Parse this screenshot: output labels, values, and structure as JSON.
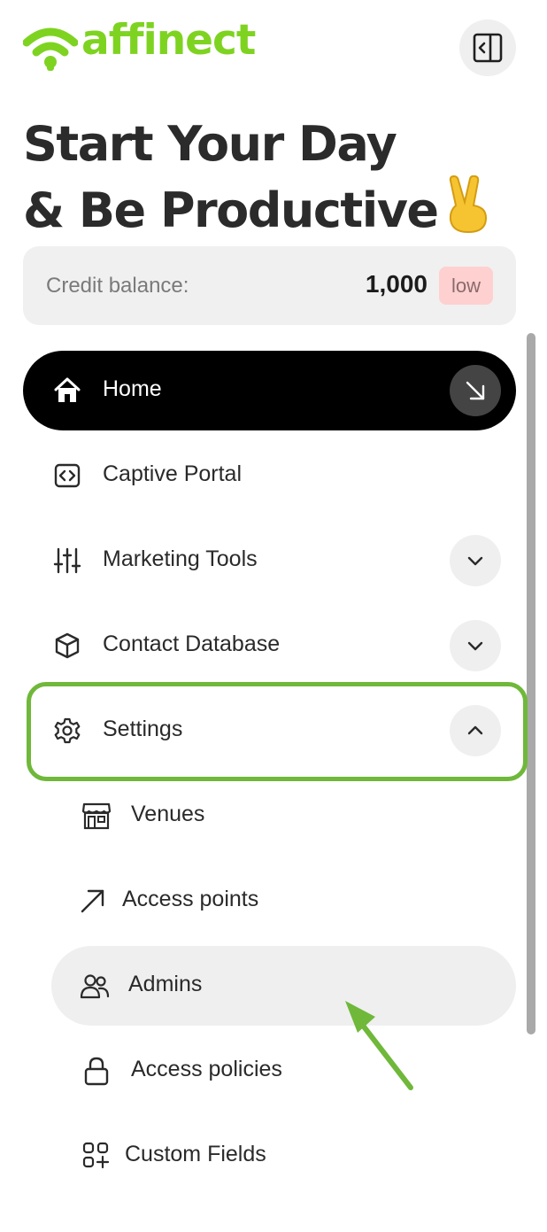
{
  "brand": {
    "name": "affinect",
    "color": "#7ed321"
  },
  "header": {
    "collapse_icon": "sidebar-collapse-icon"
  },
  "headline": {
    "line1": "Start Your Day",
    "line2": "& Be Productive",
    "emoji": "victory-hand-emoji"
  },
  "credit": {
    "label": "Credit balance:",
    "value": "1,000",
    "badge": "low"
  },
  "nav": {
    "home": {
      "label": "Home",
      "icon": "home-icon",
      "action_icon": "arrow-down-right-icon"
    },
    "captive_portal": {
      "label": "Captive Portal",
      "icon": "code-icon"
    },
    "marketing_tools": {
      "label": "Marketing Tools",
      "icon": "sliders-icon",
      "expanded": false
    },
    "contact_database": {
      "label": "Contact Database",
      "icon": "cube-icon",
      "expanded": false
    },
    "settings": {
      "label": "Settings",
      "icon": "gear-icon",
      "expanded": true,
      "children": [
        {
          "label": "Venues",
          "icon": "storefront-icon"
        },
        {
          "label": "Access points",
          "icon": "arrow-up-right-icon"
        },
        {
          "label": "Admins",
          "icon": "users-icon",
          "selected": true
        },
        {
          "label": "Access policies",
          "icon": "lock-icon"
        },
        {
          "label": "Custom Fields",
          "icon": "grid-plus-icon"
        }
      ]
    }
  },
  "colors": {
    "active_bg": "#000000",
    "highlight": "#6fb83a",
    "badge_bg": "#ffd0d0"
  }
}
